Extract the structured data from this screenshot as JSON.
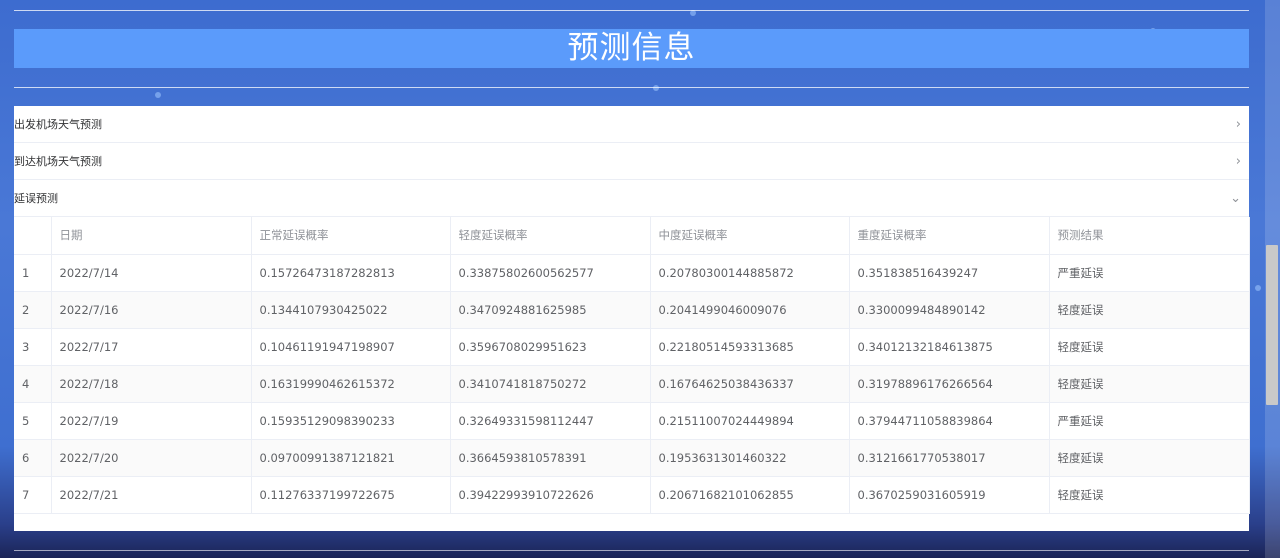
{
  "page_title": "预测信息",
  "accordion": [
    {
      "label": "出发机场天气预测",
      "expanded": false,
      "icon": "chevron-right-icon"
    },
    {
      "label": "到达机场天气预测",
      "expanded": false,
      "icon": "chevron-right-icon"
    },
    {
      "label": "延误预测",
      "expanded": true,
      "icon": "chevron-down-icon"
    }
  ],
  "table": {
    "headers": [
      "",
      "日期",
      "正常延误概率",
      "轻度延误概率",
      "中度延误概率",
      "重度延误概率",
      "预测结果"
    ],
    "rows": [
      [
        "1",
        "2022/7/14",
        "0.15726473187282813",
        "0.33875802600562577",
        "0.20780300144885872",
        "0.351838516439247",
        "严重延误"
      ],
      [
        "2",
        "2022/7/16",
        "0.1344107930425022",
        "0.3470924881625985",
        "0.2041499046009076",
        "0.3300099484890142",
        "轻度延误"
      ],
      [
        "3",
        "2022/7/17",
        "0.10461191947198907",
        "0.3596708029951623",
        "0.22180514593313685",
        "0.34012132184613875",
        "轻度延误"
      ],
      [
        "4",
        "2022/7/18",
        "0.16319990462615372",
        "0.3410741818750272",
        "0.16764625038436337",
        "0.31978896176266564",
        "轻度延误"
      ],
      [
        "5",
        "2022/7/19",
        "0.15935129098390233",
        "0.32649331598112447",
        "0.21511007024449894",
        "0.37944711058839864",
        "严重延误"
      ],
      [
        "6",
        "2022/7/20",
        "0.09700991387121821",
        "0.3664593810578391",
        "0.1953631301460322",
        "0.3121661770538017",
        "轻度延误"
      ],
      [
        "7",
        "2022/7/21",
        "0.11276337199722675",
        "0.39422993910722626",
        "0.20671682101062855",
        "0.3670259031605919",
        "轻度延误"
      ]
    ]
  }
}
